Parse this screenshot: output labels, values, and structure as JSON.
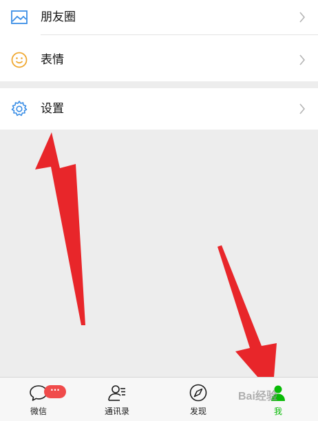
{
  "menu": {
    "moments": {
      "label": "朋友圈",
      "icon": "picture-icon"
    },
    "stickers": {
      "label": "表情",
      "icon": "smiley-icon"
    },
    "settings": {
      "label": "设置",
      "icon": "gear-icon"
    }
  },
  "tabbar": {
    "chats": {
      "label": "微信",
      "icon": "chat-bubble-icon",
      "badge": "···"
    },
    "contacts": {
      "label": "通讯录",
      "icon": "contacts-icon"
    },
    "discover": {
      "label": "发现",
      "icon": "compass-icon"
    },
    "me": {
      "label": "我",
      "icon": "person-icon",
      "active": true
    }
  },
  "watermark": {
    "text": "Bai经验"
  },
  "colors": {
    "accent": "#09bb07",
    "badge": "#f04b4b",
    "arrow": "#e8262a",
    "moments_icon": "#3a8ee6",
    "stickers_icon": "#f0a830",
    "settings_icon": "#3a8ee6"
  }
}
